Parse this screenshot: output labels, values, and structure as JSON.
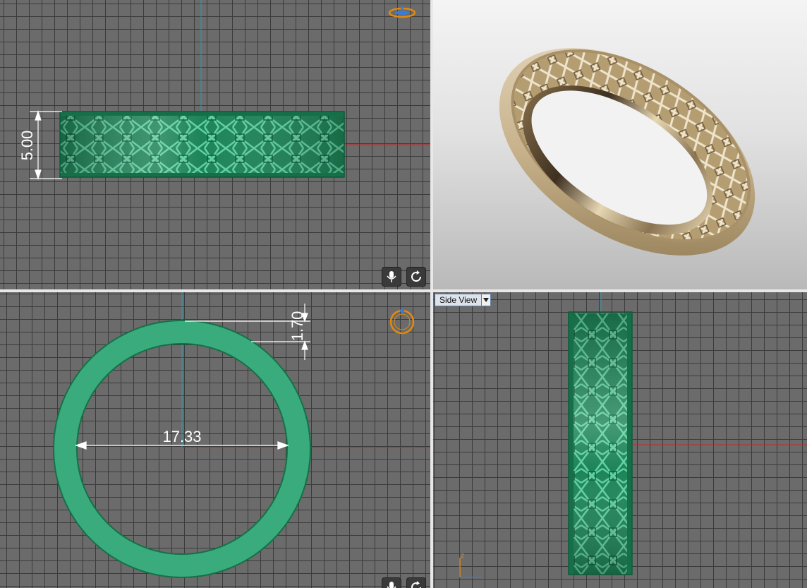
{
  "viewports": {
    "front": {
      "dimension_height": "5.00"
    },
    "perspective": {},
    "top": {
      "dimension_thickness": "1.70",
      "dimension_diameter": "17.33"
    },
    "side": {
      "view_label": "Side View",
      "axis_label": "z"
    }
  },
  "icons": {
    "mic": "microphone-icon",
    "rotate": "rotate-icon",
    "dropdown": "chevron-down-icon",
    "gizmo": "view-gizmo-icon"
  },
  "colors": {
    "ring_green": "#2e9e70",
    "ring_gold": "#c8b28c",
    "dimension_line": "#ffffff",
    "axis_red": "#c0282a",
    "axis_cyan": "#2a9bb0",
    "gizmo_orange": "#e08a10"
  }
}
